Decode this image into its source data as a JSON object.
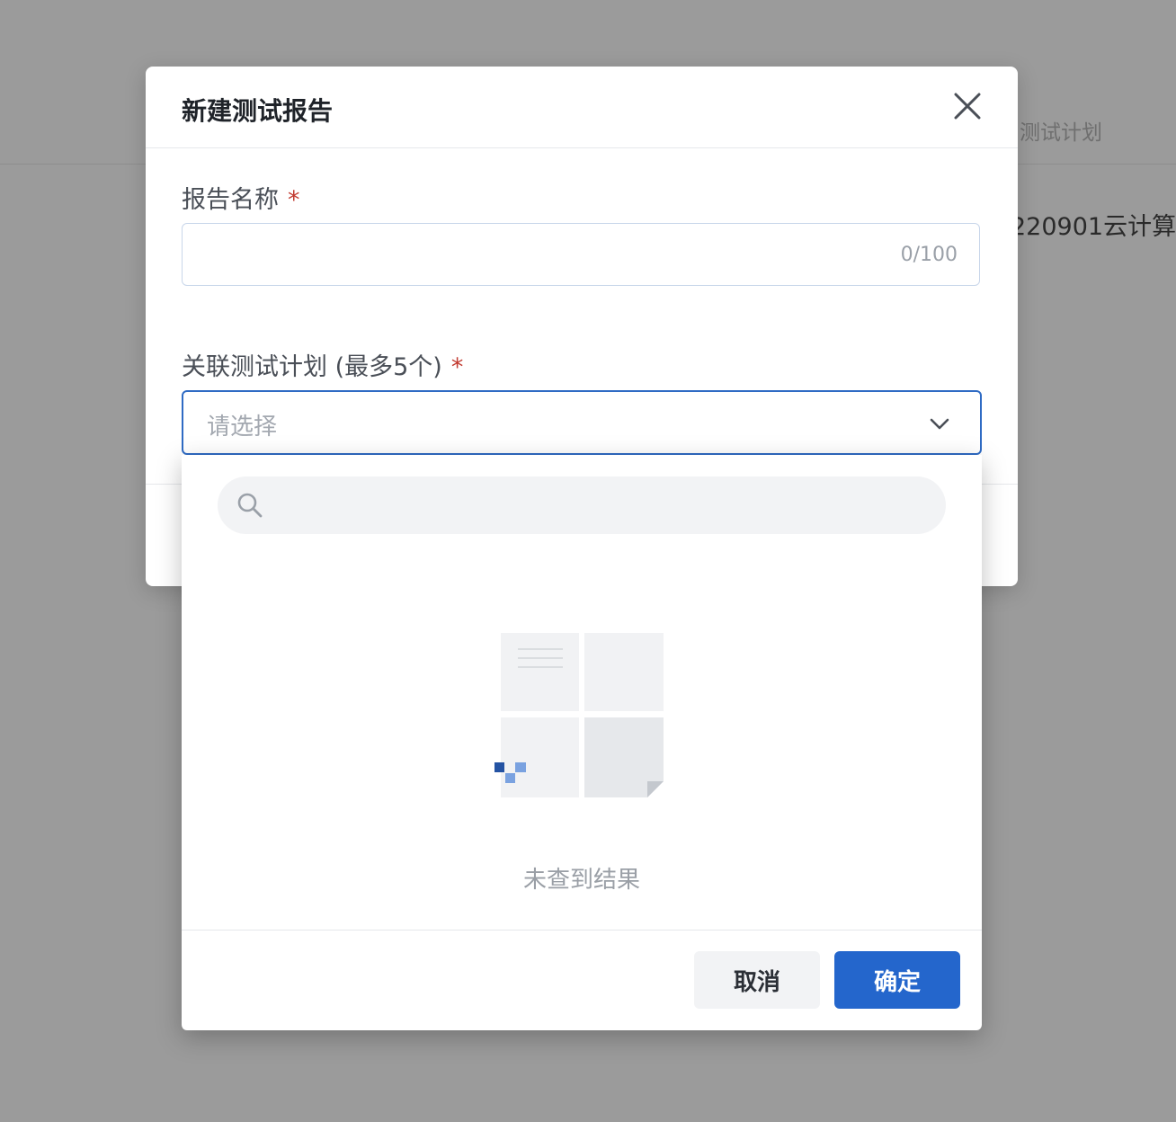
{
  "background": {
    "tab_label": "测试计划",
    "row_text": "220901云计算"
  },
  "modal": {
    "title": "新建测试报告",
    "close_icon": "close-icon",
    "report_name": {
      "label": "报告名称",
      "required_mark": "*",
      "value": "",
      "counter": "0/100"
    },
    "linked_plans": {
      "label": "关联测试计划 (最多5个)",
      "required_mark": "*",
      "placeholder": "请选择",
      "icon": "chevron-down-icon"
    }
  },
  "dropdown": {
    "search_icon": "search-icon",
    "search_value": "",
    "empty_text": "未查到结果",
    "cancel_label": "取消",
    "confirm_label": "确定"
  },
  "colors": {
    "primary": "#2466cc",
    "required": "#c23b31",
    "overlay": "#9b9b9b"
  }
}
